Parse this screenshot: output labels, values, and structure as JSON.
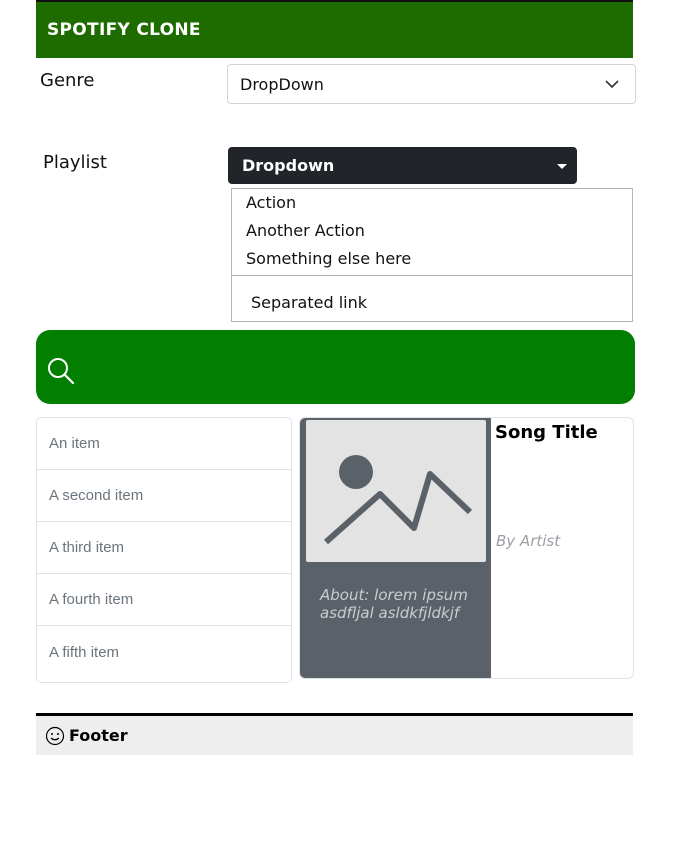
{
  "header": {
    "title": "SPOTIFY CLONE"
  },
  "genre": {
    "label": "Genre",
    "selected": "DropDown"
  },
  "playlist": {
    "label": "Playlist",
    "button_label": "Dropdown",
    "menu_items": [
      "Action",
      "Another Action",
      "Something else here"
    ],
    "separated_item": "Separated link"
  },
  "list": {
    "items": [
      "An item",
      "A second item",
      "A third item",
      "A fourth item",
      "A fifth item"
    ]
  },
  "song_card": {
    "title": "Song Title",
    "artist": "By Artist",
    "about": "About: lorem ipsum asdfljal asldkfjldkjf"
  },
  "footer": {
    "text": "Footer"
  },
  "colors": {
    "header_bg": "#1e6b00",
    "search_bg": "#027e00",
    "dropdown_btn_bg": "#212529",
    "card_dark_bg": "#5a6168",
    "footer_bg": "#eeeeee"
  },
  "icons": [
    "search-icon",
    "chevron-down-icon",
    "caret-down-icon",
    "image-placeholder-icon",
    "smiley-icon"
  ]
}
